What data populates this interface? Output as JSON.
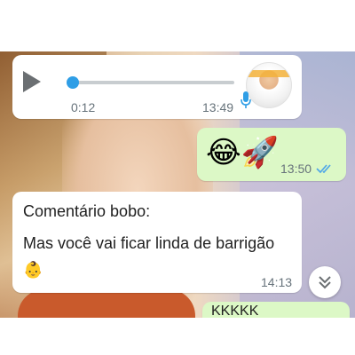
{
  "voice_message": {
    "duration": "0:12",
    "time": "13:49",
    "progress": 0.0,
    "accent_color": "#2f9ee6"
  },
  "emoji_message": {
    "emojis": "😂🚀",
    "time": "13:50",
    "status_icon": "double-check-read-icon",
    "status_color": "#4fa7e8"
  },
  "text_message": {
    "line1": "Comentário bobo:",
    "line2": "Mas você vai ficar linda de barrigão",
    "emoji": "👶",
    "time": "14:13"
  },
  "partial_message": {
    "text": "KKKKK"
  },
  "scroll_button": {
    "icon": "double-chevron-down-icon"
  },
  "colors": {
    "incoming_bubble": "#ffffff",
    "outgoing_bubble": "#dcf8c6",
    "timestamp": "#67737b"
  }
}
